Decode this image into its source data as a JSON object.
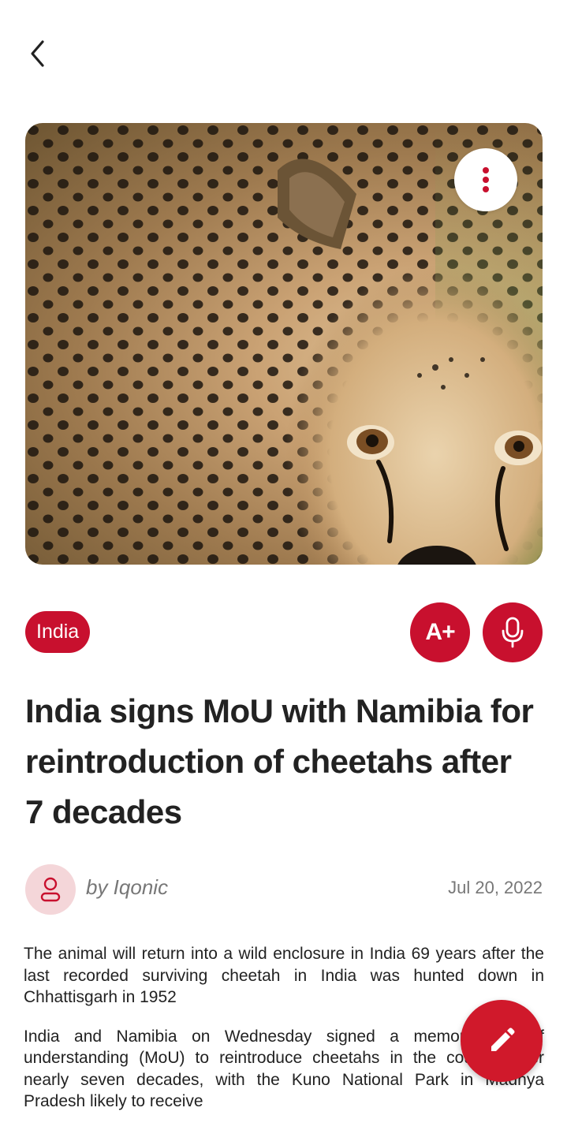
{
  "article": {
    "category": "India",
    "font_button_label": "A+",
    "title": "India signs MoU with Namibia for reintroduction of cheetahs after 7 decades",
    "author": "by Iqonic",
    "date": "Jul 20, 2022",
    "paragraphs": [
      "The animal will return into a wild enclosure in India 69 years after the last recorded surviving cheetah in India was hunted down in Chhattisgarh in 1952",
      "India and Namibia on Wednesday signed a memorandum of understanding (MoU) to reintroduce cheetahs in the country after nearly seven decades, with the Kuno National Park in Madhya Pradesh likely to receive"
    ]
  },
  "icons": {
    "back": "chevron-left-icon",
    "more": "more-vertical-icon",
    "mic": "microphone-icon",
    "avatar": "user-icon",
    "edit": "pencil-icon"
  },
  "colors": {
    "accent": "#c8102e",
    "avatar_bg": "#f4d6d9",
    "muted_text": "#777777"
  }
}
